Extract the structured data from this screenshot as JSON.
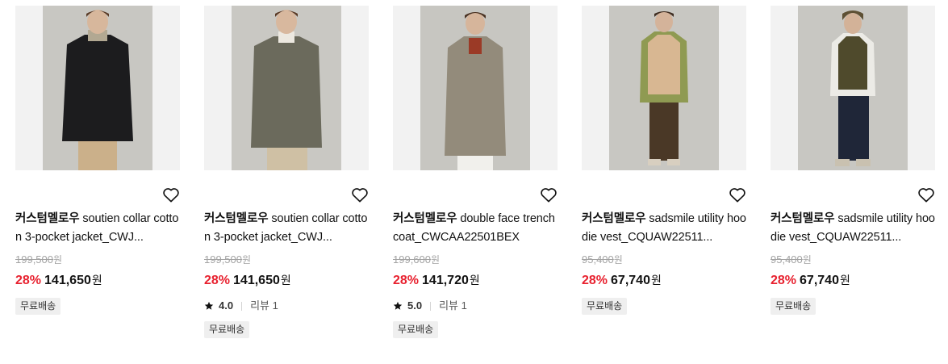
{
  "products": [
    {
      "brand": "커스텀멜로우",
      "name": " soutien collar cotton 3-pocket jacket_CWJ...",
      "original_price": "199,500",
      "currency": "원",
      "discount": "28%",
      "price": "141,650",
      "rating": null,
      "review": null,
      "badge": "무료배송",
      "liked": false
    },
    {
      "brand": "커스텀멜로우",
      "name": " soutien collar cotton 3-pocket jacket_CWJ...",
      "original_price": "199,500",
      "currency": "원",
      "discount": "28%",
      "price": "141,650",
      "rating": "4.0",
      "review": "리뷰 1",
      "badge": "무료배송",
      "liked": false
    },
    {
      "brand": "커스텀멜로우",
      "name": " double face trench coat_CWCAA22501BEX",
      "original_price": "199,600",
      "currency": "원",
      "discount": "28%",
      "price": "141,720",
      "rating": "5.0",
      "review": "리뷰 1",
      "badge": "무료배송",
      "liked": false
    },
    {
      "brand": "커스텀멜로우",
      "name": " sadsmile utility hoodie vest_CQUAW22511...",
      "original_price": "95,400",
      "currency": "원",
      "discount": "28%",
      "price": "67,740",
      "rating": null,
      "review": null,
      "badge": "무료배송",
      "liked": false
    },
    {
      "brand": "커스텀멜로우",
      "name": " sadsmile utility hoodie vest_CQUAW22511...",
      "original_price": "95,400",
      "currency": "원",
      "discount": "28%",
      "price": "67,740",
      "rating": null,
      "review": null,
      "badge": "무료배송",
      "liked": false
    }
  ],
  "icons": {
    "like": "heart-outline-icon",
    "rating": "star-icon"
  },
  "colors": {
    "discount": "#e8212f",
    "original_price": "#a3a3a3",
    "badge_bg": "#efefef",
    "thumb_bg": "#f2f2f2"
  }
}
